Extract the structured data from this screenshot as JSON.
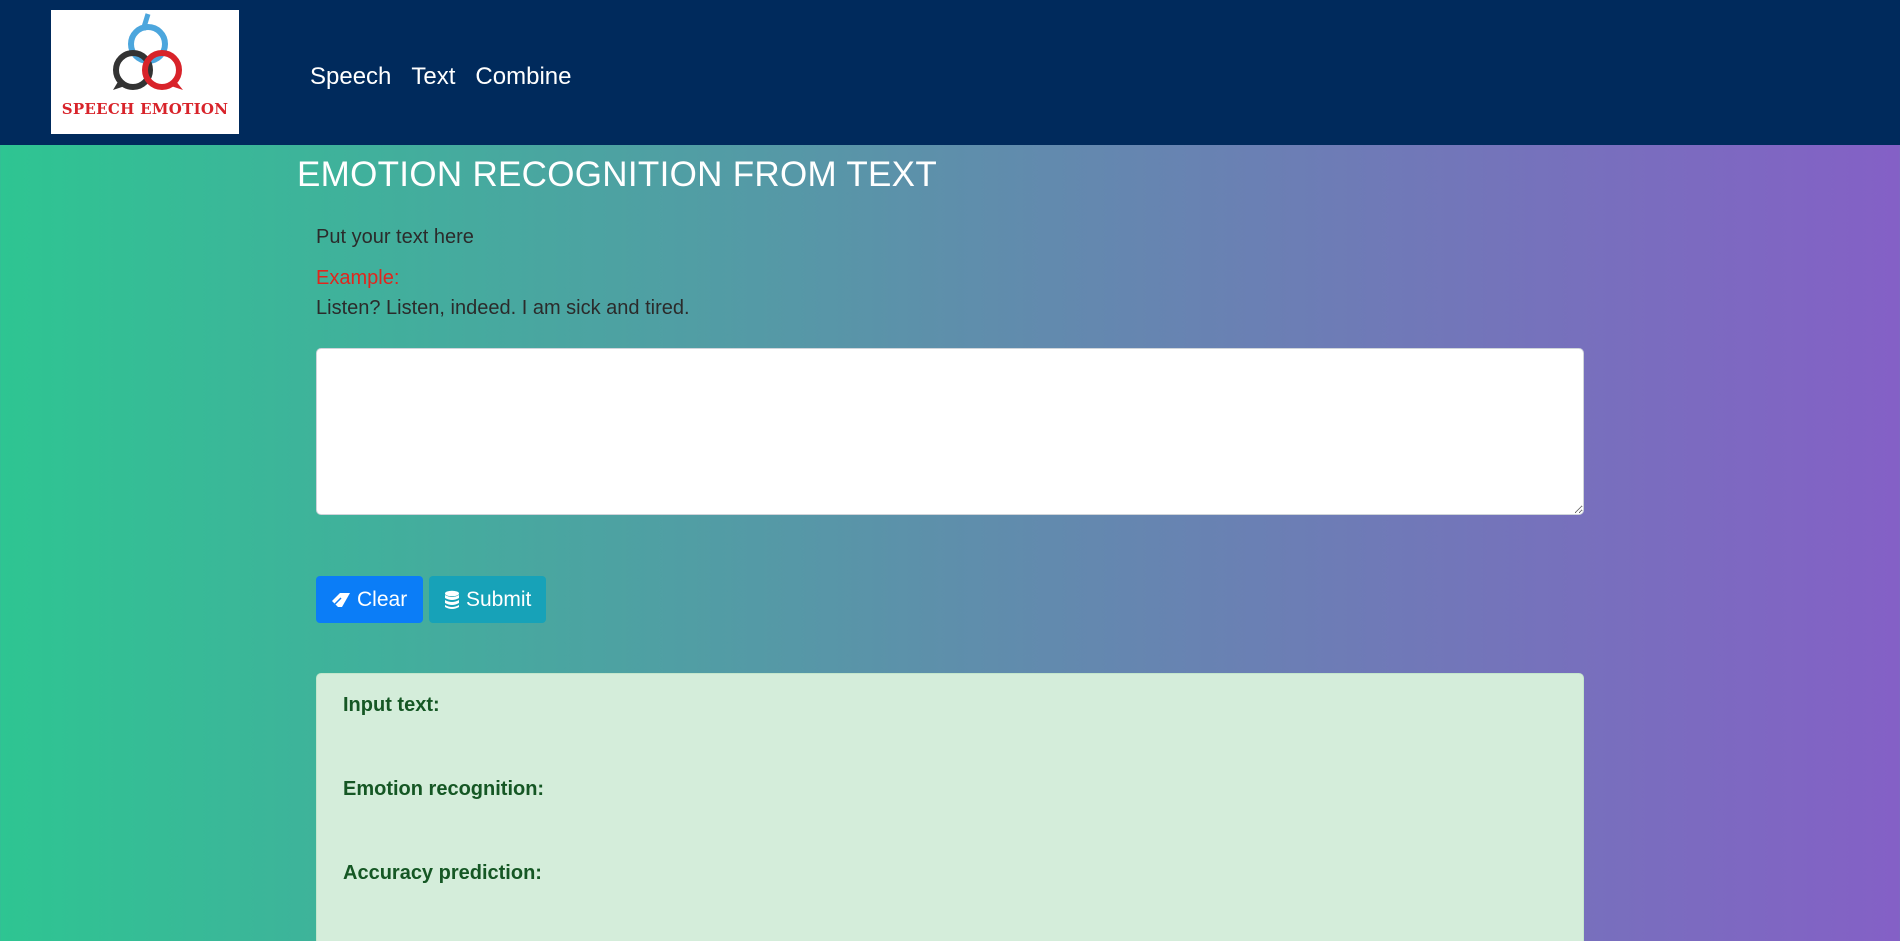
{
  "logo": {
    "text": "SPEECH EMOTION"
  },
  "nav": {
    "items": [
      {
        "label": "Speech"
      },
      {
        "label": "Text"
      },
      {
        "label": "Combine"
      }
    ]
  },
  "main": {
    "title": "EMOTION RECOGNITION FROM TEXT",
    "prompt": "Put your text here",
    "example_label": "Example:",
    "example_text": "Listen? Listen, indeed. I am sick and tired.",
    "textarea_value": ""
  },
  "buttons": {
    "clear": {
      "label": "Clear",
      "icon": "eraser-icon",
      "color": "#0b7df7"
    },
    "submit": {
      "label": "Submit",
      "icon": "database-icon",
      "color": "#17a2b8"
    }
  },
  "results": {
    "input_text_label": "Input text:",
    "emotion_label": "Emotion recognition:",
    "accuracy_label": "Accuracy prediction:"
  },
  "colors": {
    "navbar": "#002a5c",
    "gradient_start": "#2ec592",
    "gradient_end": "#8460c6",
    "example_label": "#e0261d",
    "result_bg": "#d4edda",
    "result_text": "#155724"
  }
}
